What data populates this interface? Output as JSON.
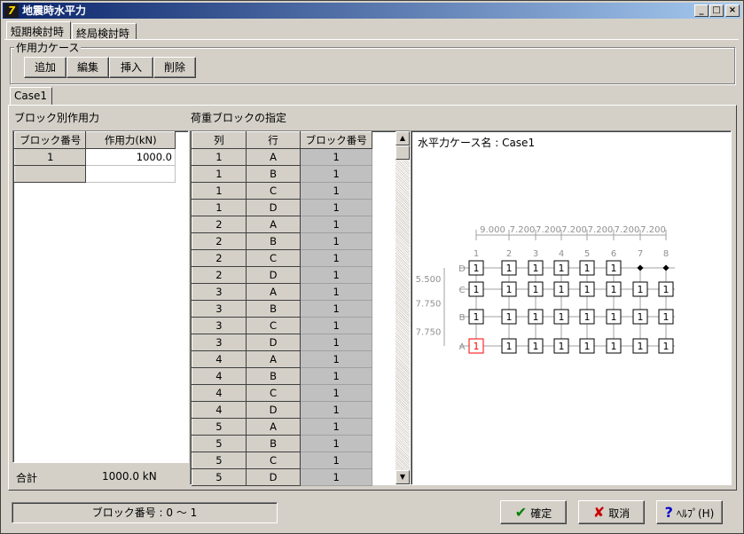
{
  "window": {
    "title": "地震時水平力",
    "app_icon": "7"
  },
  "tabs": [
    "短期検討時",
    "終局検討時"
  ],
  "case_group": {
    "label": "作用力ケース",
    "buttons": [
      "追加",
      "編集",
      "挿入",
      "削除"
    ]
  },
  "case_tab": "Case1",
  "block_force": {
    "title": "ブロック別作用力",
    "headers": [
      "ブロック番号",
      "作用力(kN)"
    ],
    "rows": [
      [
        "1",
        "1000.0"
      ]
    ],
    "total_label": "合計",
    "total_value": "1000.0 kN"
  },
  "load_block": {
    "title": "荷重ブロックの指定",
    "headers": [
      "列",
      "行",
      "ブロック番号"
    ],
    "rows": [
      [
        "1",
        "A",
        "1"
      ],
      [
        "1",
        "B",
        "1"
      ],
      [
        "1",
        "C",
        "1"
      ],
      [
        "1",
        "D",
        "1"
      ],
      [
        "2",
        "A",
        "1"
      ],
      [
        "2",
        "B",
        "1"
      ],
      [
        "2",
        "C",
        "1"
      ],
      [
        "2",
        "D",
        "1"
      ],
      [
        "3",
        "A",
        "1"
      ],
      [
        "3",
        "B",
        "1"
      ],
      [
        "3",
        "C",
        "1"
      ],
      [
        "3",
        "D",
        "1"
      ],
      [
        "4",
        "A",
        "1"
      ],
      [
        "4",
        "B",
        "1"
      ],
      [
        "4",
        "C",
        "1"
      ],
      [
        "4",
        "D",
        "1"
      ],
      [
        "5",
        "A",
        "1"
      ],
      [
        "5",
        "B",
        "1"
      ],
      [
        "5",
        "C",
        "1"
      ],
      [
        "5",
        "D",
        "1"
      ]
    ]
  },
  "diagram": {
    "case_name": "水平力ケース名 : Case1",
    "col_labels": [
      "1",
      "2",
      "3",
      "4",
      "5",
      "6",
      "7",
      "8"
    ],
    "spans_x": [
      "9.000",
      "7.200",
      "7.200",
      "7.200",
      "7.200",
      "7.200",
      "7.200"
    ],
    "row_labels": [
      "D",
      "C",
      "B",
      "A"
    ],
    "spans_y": [
      "5.500",
      "7.750",
      "7.750"
    ],
    "node_value": "1"
  },
  "status": {
    "text": "ブロック番号 : 0 〜 1"
  },
  "footer": {
    "ok": "確定",
    "cancel": "取消",
    "help": "ﾍﾙﾌﾟ(H)"
  },
  "colors": {
    "title_bar": "#0a246a",
    "highlight": "#ff0000",
    "ok_icon": "#008000",
    "cancel_icon": "#cc0000",
    "help_icon": "#0000cc"
  }
}
